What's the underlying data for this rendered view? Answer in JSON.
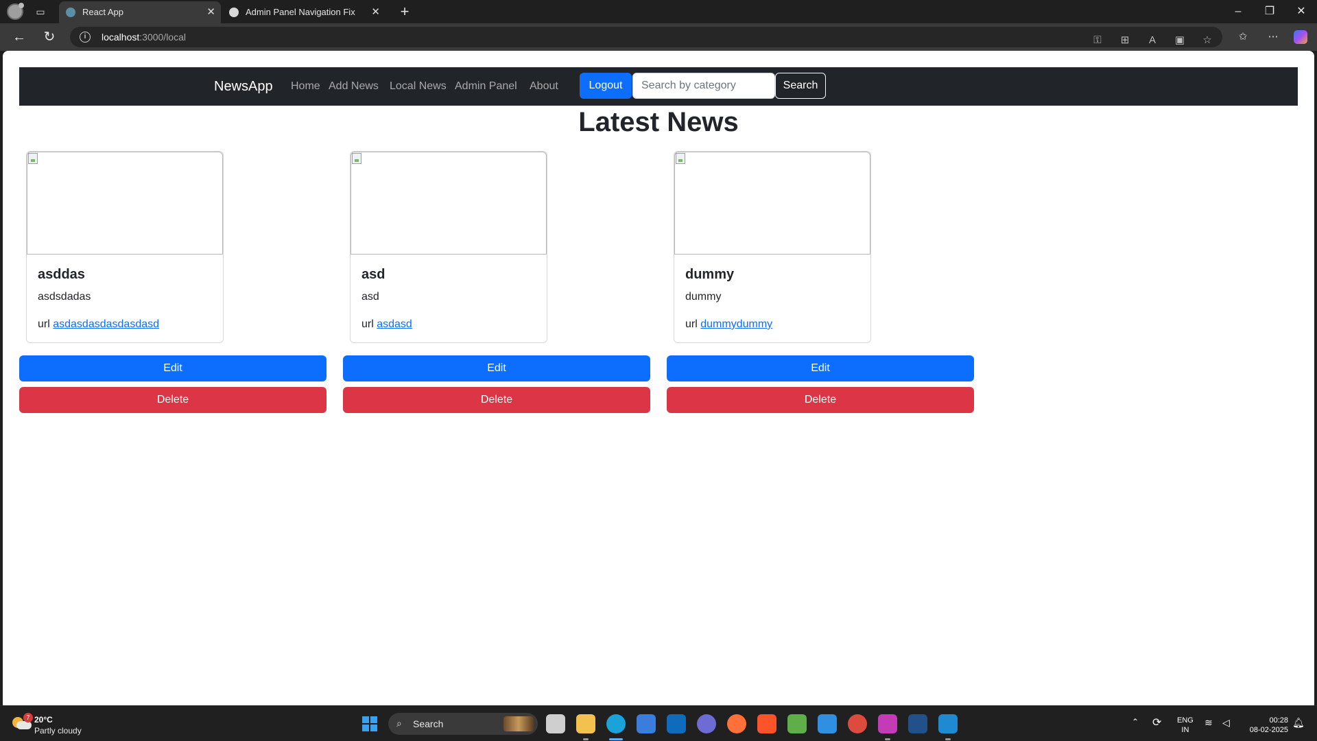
{
  "browser": {
    "tabs": [
      {
        "title": "React App",
        "active": true
      },
      {
        "title": "Admin Panel Navigation Fix",
        "active": false
      }
    ],
    "url_host": "localhost",
    "url_path": ":3000/local"
  },
  "navbar": {
    "brand": "NewsApp",
    "links": [
      "Home",
      "Add News",
      "Local News",
      "Admin Panel",
      "About"
    ],
    "logout_label": "Logout",
    "search_placeholder": "Search by category",
    "search_button": "Search"
  },
  "page": {
    "title": "Latest News",
    "edit_label": "Edit",
    "delete_label": "Delete",
    "url_prefix": "url",
    "cards": [
      {
        "title": "asddas",
        "description": "asdsdadas",
        "url": "asdasdasdasdasdasd"
      },
      {
        "title": "asd",
        "description": "asd",
        "url": "asdasd"
      },
      {
        "title": "dummy",
        "description": "dummy",
        "url": "dummydummy"
      }
    ]
  },
  "taskbar": {
    "weather_temp": "20°C",
    "weather_desc": "Partly cloudy",
    "weather_badge": "7",
    "search_label": "Search",
    "lang_top": "ENG",
    "lang_bottom": "IN",
    "time": "00:28",
    "date": "08-02-2025"
  },
  "colors": {
    "primary": "#0d6efd",
    "danger": "#dc3545",
    "navbar_bg": "#212529"
  }
}
